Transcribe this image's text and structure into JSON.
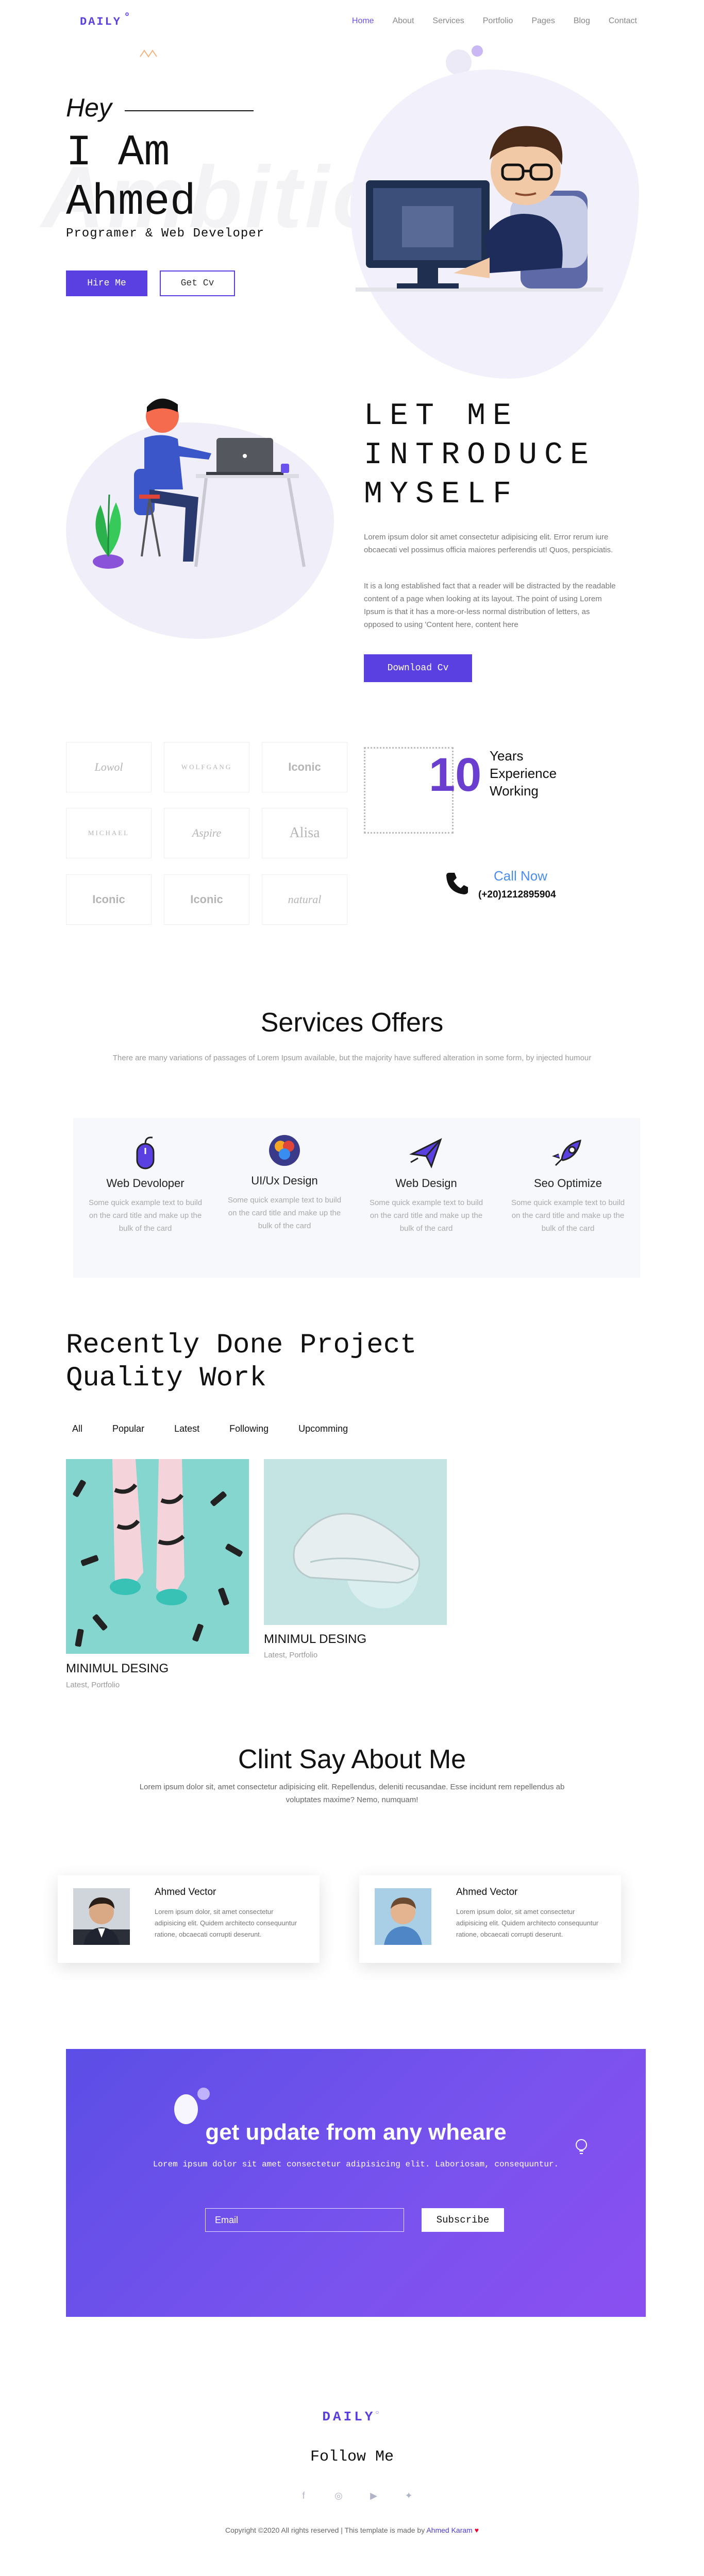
{
  "nav": {
    "logo": "DAILY",
    "items": [
      "Home",
      "About",
      "Services",
      "Portfolio",
      "Pages",
      "Blog",
      "Contact"
    ],
    "active_index": 0
  },
  "hero": {
    "greeting": "Hey",
    "name_line1": "I Am",
    "name_line2": "Ahmed",
    "role": "Programer & Web Developer",
    "background_word": "Ambition",
    "hire_button": "Hire Me",
    "cv_button": "Get Cv"
  },
  "intro": {
    "title_lines": [
      "LET ME",
      "INTRODUCE",
      "MYSELF"
    ],
    "paragraph1": "Lorem ipsum dolor sit amet consectetur adipisicing elit. Error rerum iure obcaecati vel possimus officia maiores perferendis ut! Quos, perspiciatis.",
    "paragraph2": "It is a long established fact that a reader will be distracted by the readable content of a page when looking at its layout. The point of using Lorem Ipsum is that it has a more-or-less normal distribution of letters, as opposed to using 'Content here, content here",
    "download_button": "Download Cv"
  },
  "brands": [
    "Lowol",
    "WOLFGANG",
    "Iconic",
    "MICHAEL",
    "Aspire",
    "Alisa",
    "Iconic",
    "Iconic",
    "natural"
  ],
  "experience": {
    "years": "10",
    "label_lines": [
      "Years",
      "Experience",
      "Working"
    ]
  },
  "contact": {
    "call_label": "Call Now",
    "phone": "(+20)1212895904"
  },
  "services": {
    "title": "Services Offers",
    "subtitle": "There are many variations of passages of Lorem Ipsum available, but the majority have suffered alteration in some form, by injected humour",
    "items": [
      {
        "title": "Web Devoloper",
        "text": "Some quick example text to build on the card title and make up the bulk of the card",
        "icon": "mouse-icon"
      },
      {
        "title": "UI/Ux Design",
        "text": "Some quick example text to build on the card title and make up the bulk of the card",
        "icon": "color-circles-icon"
      },
      {
        "title": "Web Design",
        "text": "Some quick example text to build on the card title and make up the bulk of the card",
        "icon": "paper-plane-icon"
      },
      {
        "title": "Seo Optimize",
        "text": "Some quick example text to build on the card title and make up the bulk of the card",
        "icon": "rocket-icon"
      }
    ]
  },
  "projects": {
    "title_line1": "Recently Done Project",
    "title_line2": "Quality Work",
    "filters": [
      "All",
      "Popular",
      "Latest",
      "Following",
      "Upcomming"
    ],
    "active_filter": 0,
    "items": [
      {
        "name": "MINIMUL DESING",
        "tags": "Latest, Portfolio"
      },
      {
        "name": "MINIMUL DESING",
        "tags": "Latest, Portfolio"
      }
    ]
  },
  "testimonials": {
    "title": "Clint Say About Me",
    "subtitle_line1": "Lorem ipsum dolor sit, amet consectetur adipisicing elit. Repellendus, deleniti recusandae. Esse incidunt rem repellendus ab",
    "subtitle_line2": "voluptates maxime? Nemo, numquam!",
    "items": [
      {
        "name": "Ahmed Vector",
        "text": "Lorem ipsum dolor, sit amet consectetur adipisicing elit. Quidem architecto consequuntur ratione, obcaecati corrupti deserunt."
      },
      {
        "name": "Ahmed Vector",
        "text": "Lorem ipsum dolor, sit amet consectetur adipisicing elit. Quidem architecto consequuntur ratione, obcaecati corrupti deserunt."
      }
    ]
  },
  "newsletter": {
    "title": "get update from any wheare",
    "subtitle": "Lorem ipsum dolor sit amet consectetur adipisicing elit. Laboriosam, consequuntur.",
    "email_placeholder": "Email",
    "subscribe_button": "Subscribe"
  },
  "footer": {
    "logo": "DAILY",
    "follow": "Follow Me",
    "socials": [
      "facebook-icon",
      "instagram-icon",
      "youtube-icon",
      "twitter-icon"
    ],
    "copyright_prefix": "Copyright ©2020 All rights reserved | This template is made by",
    "author": "Ahmed Karam",
    "heart": "♥"
  },
  "colors": {
    "accent": "#5a40e0",
    "accent_light": "#7b5cf5",
    "call": "#4a8df0",
    "exp_number": "#6a3fd0"
  }
}
